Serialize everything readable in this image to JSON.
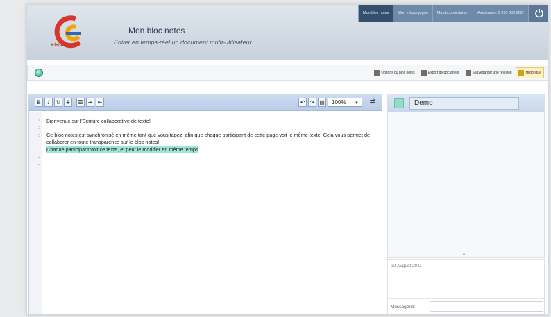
{
  "header": {
    "brand": "e-bourgogne",
    "title": "Mon bloc notes",
    "subtitle": "Editer en temps-réel un document multi-utilisateur",
    "nav": [
      {
        "label": "Mon bloc notes",
        "active": true
      },
      {
        "label": "Mon e-bourgogne",
        "active": false
      },
      {
        "label": "Ma documentation",
        "active": false
      },
      {
        "label": "Assistance: 0 970 609 909*",
        "active": false
      }
    ]
  },
  "toolbar": {
    "options": "Options du bloc notes",
    "export": "Export de document",
    "save": "Sauvegarder une révision",
    "history": "Historique"
  },
  "editor": {
    "zoom": "100%",
    "line_numbers": [
      "1",
      "2",
      "3",
      "4",
      "5"
    ],
    "lines": [
      "Bienvenue sur l'Ecriture collaborative de texte!",
      "",
      "Ce bloc notes est synchronisé en même tant que vous tapez, afin que chaque participant de cette page voit le même texte. Cela vous permet de collaborer en toute transparence sur le bloc notes!",
      "Chaque participant voit ce texte, et peut le modifier en même temps"
    ]
  },
  "users": {
    "name": "Demo",
    "color": "#93dcc9"
  },
  "chat": {
    "date": "22 August 2011",
    "label": "Messagerie:"
  }
}
